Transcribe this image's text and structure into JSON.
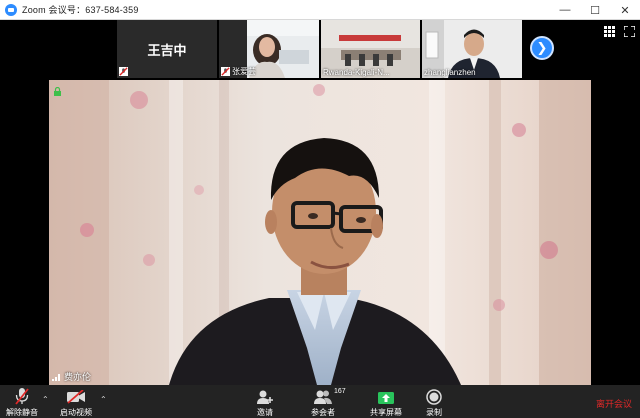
{
  "window": {
    "title": "Zoom 会议号：637-584-359",
    "minimize": "—",
    "maximize": "☐",
    "close": "✕"
  },
  "participants": [
    {
      "name": "王吉中",
      "video": false
    },
    {
      "name": "张爱芸",
      "video": true
    },
    {
      "name": "Rwanda-Kigali-N...",
      "video": true
    },
    {
      "name": "zhanglianzhen",
      "video": true
    }
  ],
  "main": {
    "speaker": "费亦伦"
  },
  "toolbar": {
    "unmute": "解除静音",
    "start_video": "启动视频",
    "invite": "邀请",
    "participants": "参会者",
    "participants_count": "167",
    "share": "共享屏幕",
    "record": "录制",
    "leave": "离开会议"
  },
  "colors": {
    "accent": "#2d8cff",
    "share_green": "#29c45c",
    "leave_red": "#e02828",
    "toolbar_bg": "#232323"
  }
}
